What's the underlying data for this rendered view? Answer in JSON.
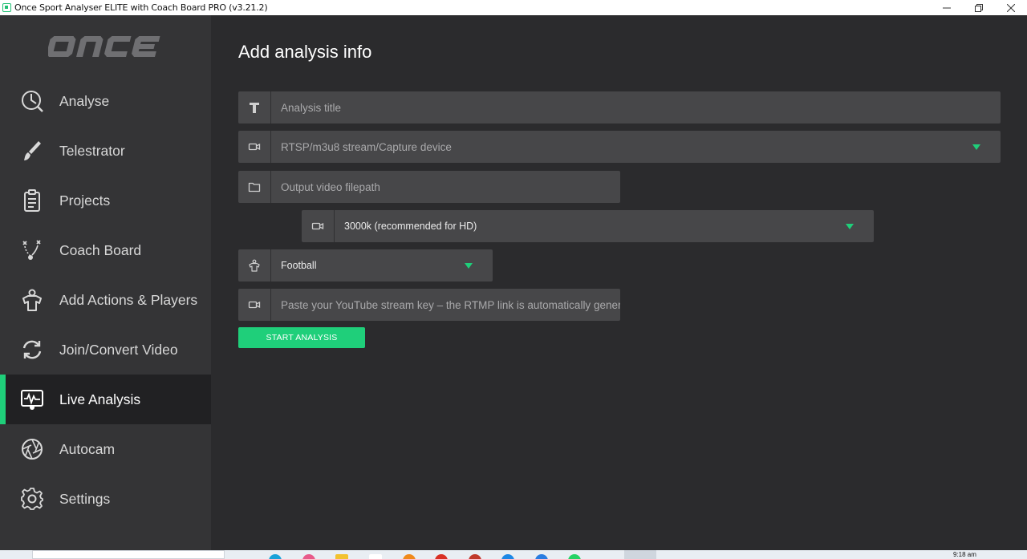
{
  "window": {
    "title": "Once Sport Analyser ELITE with Coach Board PRO (v3.21.2)"
  },
  "sidebar": {
    "logo": "ONCE",
    "items": [
      {
        "label": "Analyse",
        "icon": "analyse-icon",
        "active": false
      },
      {
        "label": "Telestrator",
        "icon": "brush-icon",
        "active": false
      },
      {
        "label": "Projects",
        "icon": "clipboard-icon",
        "active": false
      },
      {
        "label": "Coach Board",
        "icon": "tactics-icon",
        "active": false
      },
      {
        "label": "Add Actions & Players",
        "icon": "player-shirt-icon",
        "active": false
      },
      {
        "label": "Join/Convert Video",
        "icon": "sync-icon",
        "active": false
      },
      {
        "label": "Live Analysis",
        "icon": "live-monitor-icon",
        "active": true
      },
      {
        "label": "Autocam",
        "icon": "aperture-icon",
        "active": false
      },
      {
        "label": "Settings",
        "icon": "gear-icon",
        "active": false
      }
    ]
  },
  "main": {
    "title": "Add analysis info",
    "fields": {
      "analysis_title": {
        "placeholder": "Analysis title",
        "icon": "text-icon"
      },
      "stream_source": {
        "placeholder": "RTSP/m3u8 stream/Capture device",
        "icon": "camera-icon"
      },
      "output_path": {
        "placeholder": "Output video filepath",
        "icon": "folder-icon"
      },
      "bitrate": {
        "value": "3000k (recommended for HD)",
        "icon": "camera-icon"
      },
      "sport": {
        "value": "Football",
        "icon": "shirt-icon"
      },
      "stream_key": {
        "placeholder": "Paste your YouTube stream key – the RTMP link is automatically genera",
        "icon": "camera-icon"
      }
    },
    "start_button": "START ANALYSIS"
  },
  "taskbar": {
    "clock": "9:18 am"
  },
  "colors": {
    "accent": "#1fcf7a",
    "sidebar_bg": "#343436",
    "main_bg": "#2b2b2d",
    "field_bg": "#474749"
  }
}
